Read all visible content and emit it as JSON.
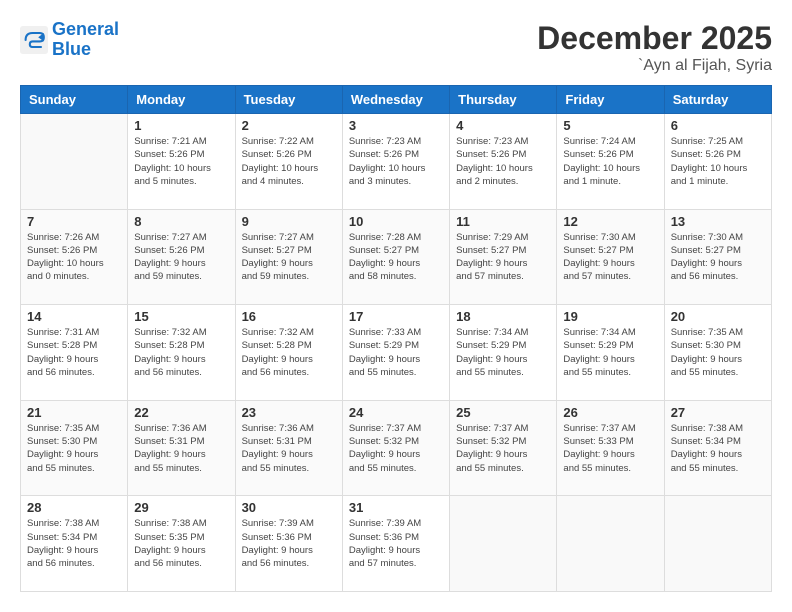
{
  "logo": {
    "line1": "General",
    "line2": "Blue"
  },
  "title": "December 2025",
  "location": "`Ayn al Fijah, Syria",
  "weekdays": [
    "Sunday",
    "Monday",
    "Tuesday",
    "Wednesday",
    "Thursday",
    "Friday",
    "Saturday"
  ],
  "weeks": [
    [
      {
        "day": "",
        "info": ""
      },
      {
        "day": "1",
        "info": "Sunrise: 7:21 AM\nSunset: 5:26 PM\nDaylight: 10 hours\nand 5 minutes."
      },
      {
        "day": "2",
        "info": "Sunrise: 7:22 AM\nSunset: 5:26 PM\nDaylight: 10 hours\nand 4 minutes."
      },
      {
        "day": "3",
        "info": "Sunrise: 7:23 AM\nSunset: 5:26 PM\nDaylight: 10 hours\nand 3 minutes."
      },
      {
        "day": "4",
        "info": "Sunrise: 7:23 AM\nSunset: 5:26 PM\nDaylight: 10 hours\nand 2 minutes."
      },
      {
        "day": "5",
        "info": "Sunrise: 7:24 AM\nSunset: 5:26 PM\nDaylight: 10 hours\nand 1 minute."
      },
      {
        "day": "6",
        "info": "Sunrise: 7:25 AM\nSunset: 5:26 PM\nDaylight: 10 hours\nand 1 minute."
      }
    ],
    [
      {
        "day": "7",
        "info": "Sunrise: 7:26 AM\nSunset: 5:26 PM\nDaylight: 10 hours\nand 0 minutes."
      },
      {
        "day": "8",
        "info": "Sunrise: 7:27 AM\nSunset: 5:26 PM\nDaylight: 9 hours\nand 59 minutes."
      },
      {
        "day": "9",
        "info": "Sunrise: 7:27 AM\nSunset: 5:27 PM\nDaylight: 9 hours\nand 59 minutes."
      },
      {
        "day": "10",
        "info": "Sunrise: 7:28 AM\nSunset: 5:27 PM\nDaylight: 9 hours\nand 58 minutes."
      },
      {
        "day": "11",
        "info": "Sunrise: 7:29 AM\nSunset: 5:27 PM\nDaylight: 9 hours\nand 57 minutes."
      },
      {
        "day": "12",
        "info": "Sunrise: 7:30 AM\nSunset: 5:27 PM\nDaylight: 9 hours\nand 57 minutes."
      },
      {
        "day": "13",
        "info": "Sunrise: 7:30 AM\nSunset: 5:27 PM\nDaylight: 9 hours\nand 56 minutes."
      }
    ],
    [
      {
        "day": "14",
        "info": "Sunrise: 7:31 AM\nSunset: 5:28 PM\nDaylight: 9 hours\nand 56 minutes."
      },
      {
        "day": "15",
        "info": "Sunrise: 7:32 AM\nSunset: 5:28 PM\nDaylight: 9 hours\nand 56 minutes."
      },
      {
        "day": "16",
        "info": "Sunrise: 7:32 AM\nSunset: 5:28 PM\nDaylight: 9 hours\nand 56 minutes."
      },
      {
        "day": "17",
        "info": "Sunrise: 7:33 AM\nSunset: 5:29 PM\nDaylight: 9 hours\nand 55 minutes."
      },
      {
        "day": "18",
        "info": "Sunrise: 7:34 AM\nSunset: 5:29 PM\nDaylight: 9 hours\nand 55 minutes."
      },
      {
        "day": "19",
        "info": "Sunrise: 7:34 AM\nSunset: 5:29 PM\nDaylight: 9 hours\nand 55 minutes."
      },
      {
        "day": "20",
        "info": "Sunrise: 7:35 AM\nSunset: 5:30 PM\nDaylight: 9 hours\nand 55 minutes."
      }
    ],
    [
      {
        "day": "21",
        "info": "Sunrise: 7:35 AM\nSunset: 5:30 PM\nDaylight: 9 hours\nand 55 minutes."
      },
      {
        "day": "22",
        "info": "Sunrise: 7:36 AM\nSunset: 5:31 PM\nDaylight: 9 hours\nand 55 minutes."
      },
      {
        "day": "23",
        "info": "Sunrise: 7:36 AM\nSunset: 5:31 PM\nDaylight: 9 hours\nand 55 minutes."
      },
      {
        "day": "24",
        "info": "Sunrise: 7:37 AM\nSunset: 5:32 PM\nDaylight: 9 hours\nand 55 minutes."
      },
      {
        "day": "25",
        "info": "Sunrise: 7:37 AM\nSunset: 5:32 PM\nDaylight: 9 hours\nand 55 minutes."
      },
      {
        "day": "26",
        "info": "Sunrise: 7:37 AM\nSunset: 5:33 PM\nDaylight: 9 hours\nand 55 minutes."
      },
      {
        "day": "27",
        "info": "Sunrise: 7:38 AM\nSunset: 5:34 PM\nDaylight: 9 hours\nand 55 minutes."
      }
    ],
    [
      {
        "day": "28",
        "info": "Sunrise: 7:38 AM\nSunset: 5:34 PM\nDaylight: 9 hours\nand 56 minutes."
      },
      {
        "day": "29",
        "info": "Sunrise: 7:38 AM\nSunset: 5:35 PM\nDaylight: 9 hours\nand 56 minutes."
      },
      {
        "day": "30",
        "info": "Sunrise: 7:39 AM\nSunset: 5:36 PM\nDaylight: 9 hours\nand 56 minutes."
      },
      {
        "day": "31",
        "info": "Sunrise: 7:39 AM\nSunset: 5:36 PM\nDaylight: 9 hours\nand 57 minutes."
      },
      {
        "day": "",
        "info": ""
      },
      {
        "day": "",
        "info": ""
      },
      {
        "day": "",
        "info": ""
      }
    ]
  ]
}
